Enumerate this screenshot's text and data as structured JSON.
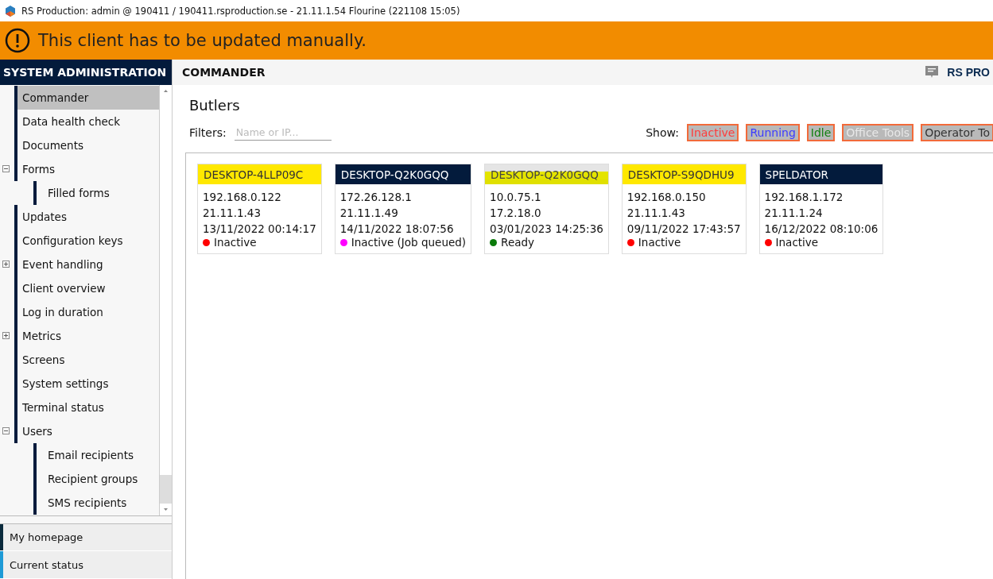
{
  "window": {
    "title": "RS Production: admin @ 190411 / 190411.rsproduction.se - 21.11.1.54 Flourine (221108 15:05)"
  },
  "banner": {
    "message": "This client has to be updated manually."
  },
  "sidebar": {
    "title": "SYSTEM ADMINISTRATION",
    "items": [
      {
        "label": "Commander",
        "selected": true
      },
      {
        "label": "Data health check",
        "selected": false
      },
      {
        "label": "Documents",
        "selected": false
      },
      {
        "label": "Forms",
        "selected": false,
        "expanded": true,
        "children": [
          {
            "label": "Filled forms",
            "selected": false
          }
        ]
      },
      {
        "label": "Updates",
        "selected": false
      },
      {
        "label": "Configuration keys",
        "selected": false
      },
      {
        "label": "Event handling",
        "selected": false,
        "expanded": false
      },
      {
        "label": "Client overview",
        "selected": false
      },
      {
        "label": "Log in duration",
        "selected": false
      },
      {
        "label": "Metrics",
        "selected": false,
        "expanded": false
      },
      {
        "label": "Screens",
        "selected": false
      },
      {
        "label": "System settings",
        "selected": false
      },
      {
        "label": "Terminal status",
        "selected": false
      },
      {
        "label": "Users",
        "selected": false,
        "expanded": true,
        "children": [
          {
            "label": "Email recipients",
            "selected": false
          },
          {
            "label": "Recipient groups",
            "selected": false
          },
          {
            "label": "SMS recipients",
            "selected": false
          }
        ]
      }
    ],
    "bottom_tabs": [
      {
        "label": "My homepage",
        "color": "#0a2a3c"
      },
      {
        "label": "Current status",
        "color": "#1e9ad6"
      }
    ]
  },
  "header": {
    "title": "COMMANDER",
    "product": "RS PRO"
  },
  "content": {
    "title": "Butlers",
    "filters_label": "Filters:",
    "filter_placeholder": "Name or IP...",
    "show_label": "Show:",
    "show_options": [
      {
        "label": "Inactive",
        "color": "#ff3b3b"
      },
      {
        "label": "Running",
        "color": "#3b3bff"
      },
      {
        "label": "Idle",
        "color": "#108010"
      },
      {
        "label": "Office Tools",
        "color": "#e8e8e8"
      },
      {
        "label": "Operator To",
        "color": "#333333"
      }
    ],
    "butlers": [
      {
        "name": "DESKTOP-4LLP09C",
        "kind": "flagged",
        "ip": "192.168.0.122",
        "version": "21.11.1.43",
        "time": "13/11/2022 00:14:17",
        "status": "Inactive",
        "color": "#ff0000"
      },
      {
        "name": "DESKTOP-Q2K0GQQ",
        "kind": "normal",
        "ip": "172.26.128.1",
        "version": "21.11.1.49",
        "time": "14/11/2022 18:07:56",
        "status": "Inactive (Job queued)",
        "color": "#ff00ff"
      },
      {
        "name": "DESKTOP-Q2K0GQQ",
        "kind": "highlighted",
        "ip": "10.0.75.1",
        "version": "17.2.18.0",
        "time": "03/01/2023 14:25:36",
        "status": "Ready",
        "color": "#0a7a0a"
      },
      {
        "name": "DESKTOP-S9QDHU9",
        "kind": "flagged",
        "ip": "192.168.0.150",
        "version": "21.11.1.43",
        "time": "09/11/2022 17:43:57",
        "status": "Inactive",
        "color": "#ff0000"
      },
      {
        "name": "SPELDATOR",
        "kind": "normal",
        "ip": "192.168.1.172",
        "version": "21.11.1.24",
        "time": "16/12/2022 08:10:06",
        "status": "Inactive",
        "color": "#ff0000"
      }
    ]
  }
}
